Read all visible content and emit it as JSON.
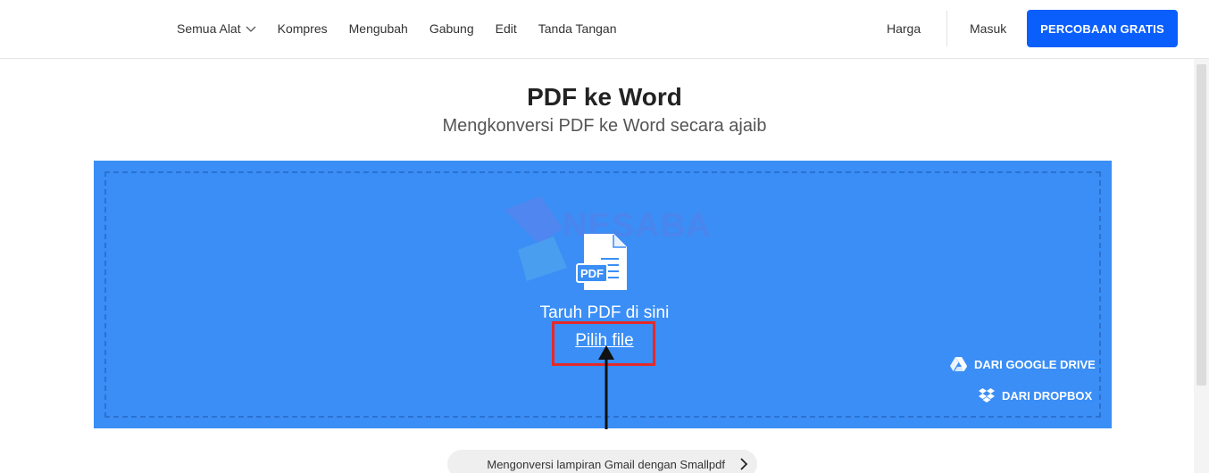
{
  "nav": {
    "items": [
      {
        "label": "Semua Alat"
      },
      {
        "label": "Kompres"
      },
      {
        "label": "Mengubah"
      },
      {
        "label": "Gabung"
      },
      {
        "label": "Edit"
      },
      {
        "label": "Tanda Tangan"
      }
    ],
    "price_label": "Harga",
    "login_label": "Masuk",
    "trial_label": "PERCOBAAN GRATIS"
  },
  "main": {
    "title": "PDF ke Word",
    "subtitle": "Mengkonversi PDF ke Word secara ajaib",
    "drop_text": "Taruh PDF di sini",
    "pick_label": "Pilih file",
    "pdf_badge": "PDF",
    "watermark": "NESABA",
    "gdrive_label": "DARI GOOGLE DRIVE",
    "dropbox_label": "DARI DROPBOX",
    "gmail_label": "Mengonversi lampiran Gmail dengan Smallpdf"
  },
  "colors": {
    "accent": "#0a5efb",
    "dropzone": "#3a8ef6",
    "highlight": "#e42a2a"
  }
}
